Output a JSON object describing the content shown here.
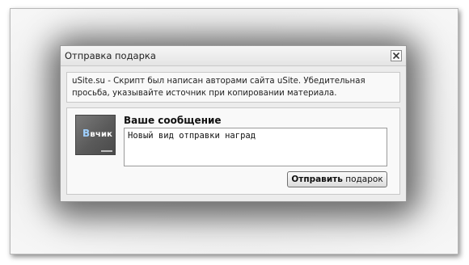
{
  "dialog": {
    "title": "Отправка подарка",
    "close_icon": "close-icon",
    "notice": "uSite.su - Скрипт был написан авторами сайта uSite. Убедительная просьба, указывайте источник при копировании материала."
  },
  "gift": {
    "image_icon": "gift-image",
    "logo_text_first": "В",
    "logo_text_rest": "вчик"
  },
  "message": {
    "label": "Ваше сообщение",
    "value": "Новый вид отправки наград"
  },
  "send_button": {
    "label_strong": "Отправить",
    "label_rest": " подарок"
  }
}
